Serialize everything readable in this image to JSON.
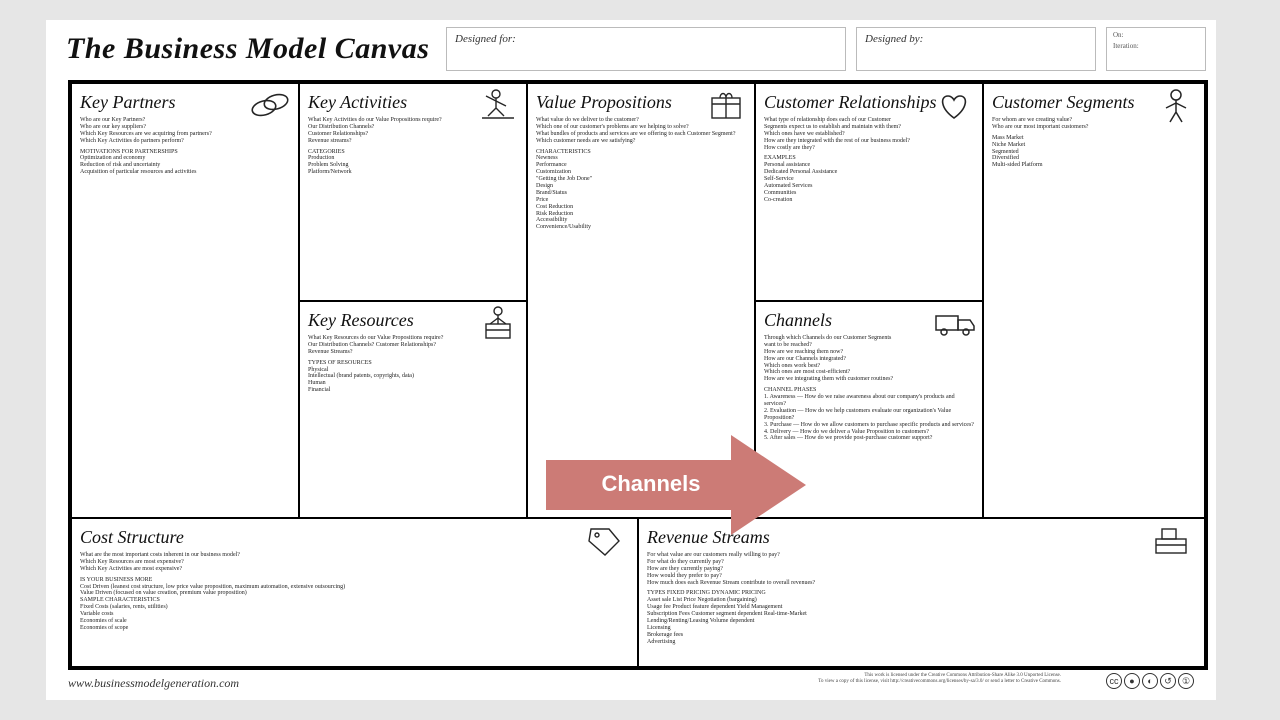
{
  "title": "The Business Model Canvas",
  "header": {
    "designed_for_label": "Designed for:",
    "designed_by_label": "Designed by:",
    "on_label": "On:",
    "iteration_label": "Iteration:"
  },
  "cells": {
    "key_partners": {
      "title": "Key Partners",
      "questions": "Who are our Key Partners?\nWho are our key suppliers?\nWhich Key Resources are we acquiring from partners?\nWhich Key Activities do partners perform?",
      "sub": "MOTIVATIONS FOR PARTNERSHIPS\nOptimization and economy\nReduction of risk and uncertainty\nAcquisition of particular resources and activities"
    },
    "key_activities": {
      "title": "Key Activities",
      "questions": "What Key Activities do our Value Propositions require?\nOur Distribution Channels?\nCustomer Relationships?\nRevenue streams?",
      "sub": "CATEGORIES\nProduction\nProblem Solving\nPlatform/Network"
    },
    "key_resources": {
      "title": "Key Resources",
      "questions": "What Key Resources do our Value Propositions require?\nOur Distribution Channels? Customer Relationships?\nRevenue Streams?",
      "sub": "TYPES OF RESOURCES\nPhysical\nIntellectual (brand patents, copyrights, data)\nHuman\nFinancial"
    },
    "value_propositions": {
      "title": "Value Propositions",
      "questions": "What value do we deliver to the customer?\nWhich one of our customer's problems are we helping to solve?\nWhat bundles of products and services are we offering to each Customer Segment?\nWhich customer needs are we satisfying?",
      "sub": "CHARACTERISTICS\nNewness\nPerformance\nCustomization\n\"Getting the Job Done\"\nDesign\nBrand/Status\nPrice\nCost Reduction\nRisk Reduction\nAccessibility\nConvenience/Usability"
    },
    "customer_relationships": {
      "title": "Customer Relationships",
      "questions": "What type of relationship does each of our Customer\nSegments expect us to establish and maintain with them?\nWhich ones have we established?\nHow are they integrated with the rest of our business model?\nHow costly are they?",
      "sub": "EXAMPLES\nPersonal assistance\nDedicated Personal Assistance\nSelf-Service\nAutomated Services\nCommunities\nCo-creation"
    },
    "channels": {
      "title": "Channels",
      "questions": "Through which Channels do our Customer Segments\nwant to be reached?\nHow are we reaching them now?\nHow are our Channels integrated?\nWhich ones work best?\nWhich ones are most cost-efficient?\nHow are we integrating them with customer routines?",
      "sub": "CHANNEL PHASES\n1. Awareness — How do we raise awareness about our company's products and services?\n2. Evaluation — How do we help customers evaluate our organization's Value Proposition?\n3. Purchase — How do we allow customers to purchase specific products and services?\n4. Delivery — How do we deliver a Value Proposition to customers?\n5. After sales — How do we provide post-purchase customer support?"
    },
    "customer_segments": {
      "title": "Customer Segments",
      "questions": "For whom are we creating value?\nWho are our most important customers?",
      "sub": "Mass Market\nNiche Market\nSegmented\nDiversified\nMulti-sided Platform"
    },
    "cost_structure": {
      "title": "Cost Structure",
      "questions": "What are the most important costs inherent in our business model?\nWhich Key Resources are most expensive?\nWhich Key Activities are most expensive?",
      "sub": "IS YOUR BUSINESS MORE\nCost Driven (leanest cost structure, low price value proposition, maximum automation, extensive outsourcing)\nValue Driven (focused on value creation, premium value proposition)\nSAMPLE CHARACTERISTICS\nFixed Costs (salaries, rents, utilities)\nVariable costs\nEconomies of scale\nEconomies of scope"
    },
    "revenue_streams": {
      "title": "Revenue Streams",
      "questions": "For what value are our customers really willing to pay?\nFor what do they currently pay?\nHow are they currently paying?\nHow would they prefer to pay?\nHow much does each Revenue Stream contribute to overall revenues?",
      "sub": "TYPES                                  FIXED PRICING                        DYNAMIC PRICING\nAsset sale                               List Price                                  Negotiation (bargaining)\nUsage fee                                Product feature dependent       Yield Management\nSubscription Fees                   Customer segment dependent  Real-time-Market\nLending/Renting/Leasing      Volume dependent\nLicensing\nBrokerage fees\nAdvertising"
    }
  },
  "callout": {
    "label": "Channels"
  },
  "footer": {
    "url": "www.businessmodelgeneration.com",
    "note": "This work is licensed under the Creative Commons Attribution-Share Alike 3.0 Unported License.\nTo view a copy of this license, visit http://creativecommons.org/licenses/by-sa/3.0/ or send a letter to Creative Commons."
  }
}
